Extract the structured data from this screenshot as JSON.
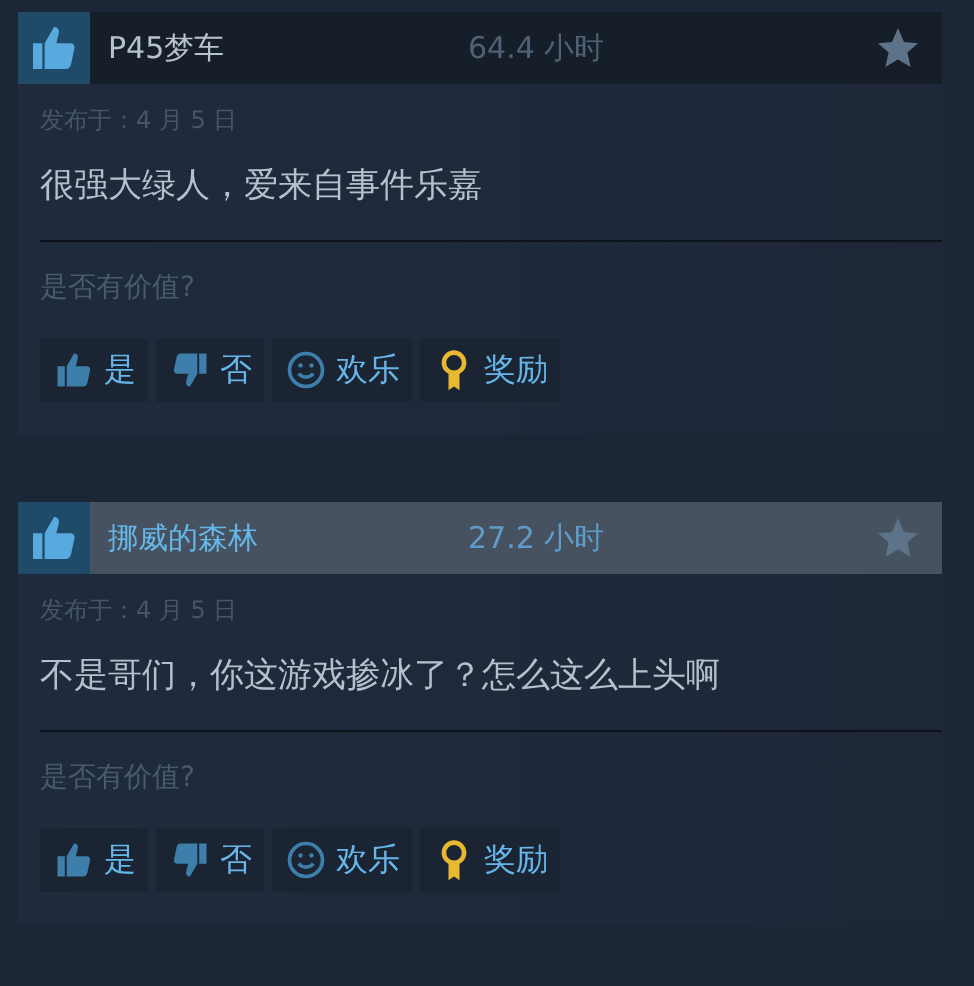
{
  "reviews": [
    {
      "recommended": true,
      "author": "P45梦车",
      "hours": "64.4 小时",
      "highlighted": false,
      "posted": "发布于：4 月 5 日",
      "text": "很强大绿人，爱来自事件乐嘉",
      "question": "是否有价值?",
      "buttons": [
        {
          "kind": "yes",
          "label": "是"
        },
        {
          "kind": "no",
          "label": "否"
        },
        {
          "kind": "funny",
          "label": "欢乐"
        },
        {
          "kind": "award",
          "label": "奖励"
        }
      ]
    },
    {
      "recommended": true,
      "author": "挪威的森林",
      "hours": "27.2 小时",
      "highlighted": true,
      "posted": "发布于：4 月 5 日",
      "text": "不是哥们，你这游戏掺冰了？怎么这么上头啊",
      "question": "是否有价值?",
      "buttons": [
        {
          "kind": "yes",
          "label": "是"
        },
        {
          "kind": "no",
          "label": "否"
        },
        {
          "kind": "funny",
          "label": "欢乐"
        },
        {
          "kind": "award",
          "label": "奖励"
        }
      ]
    }
  ]
}
